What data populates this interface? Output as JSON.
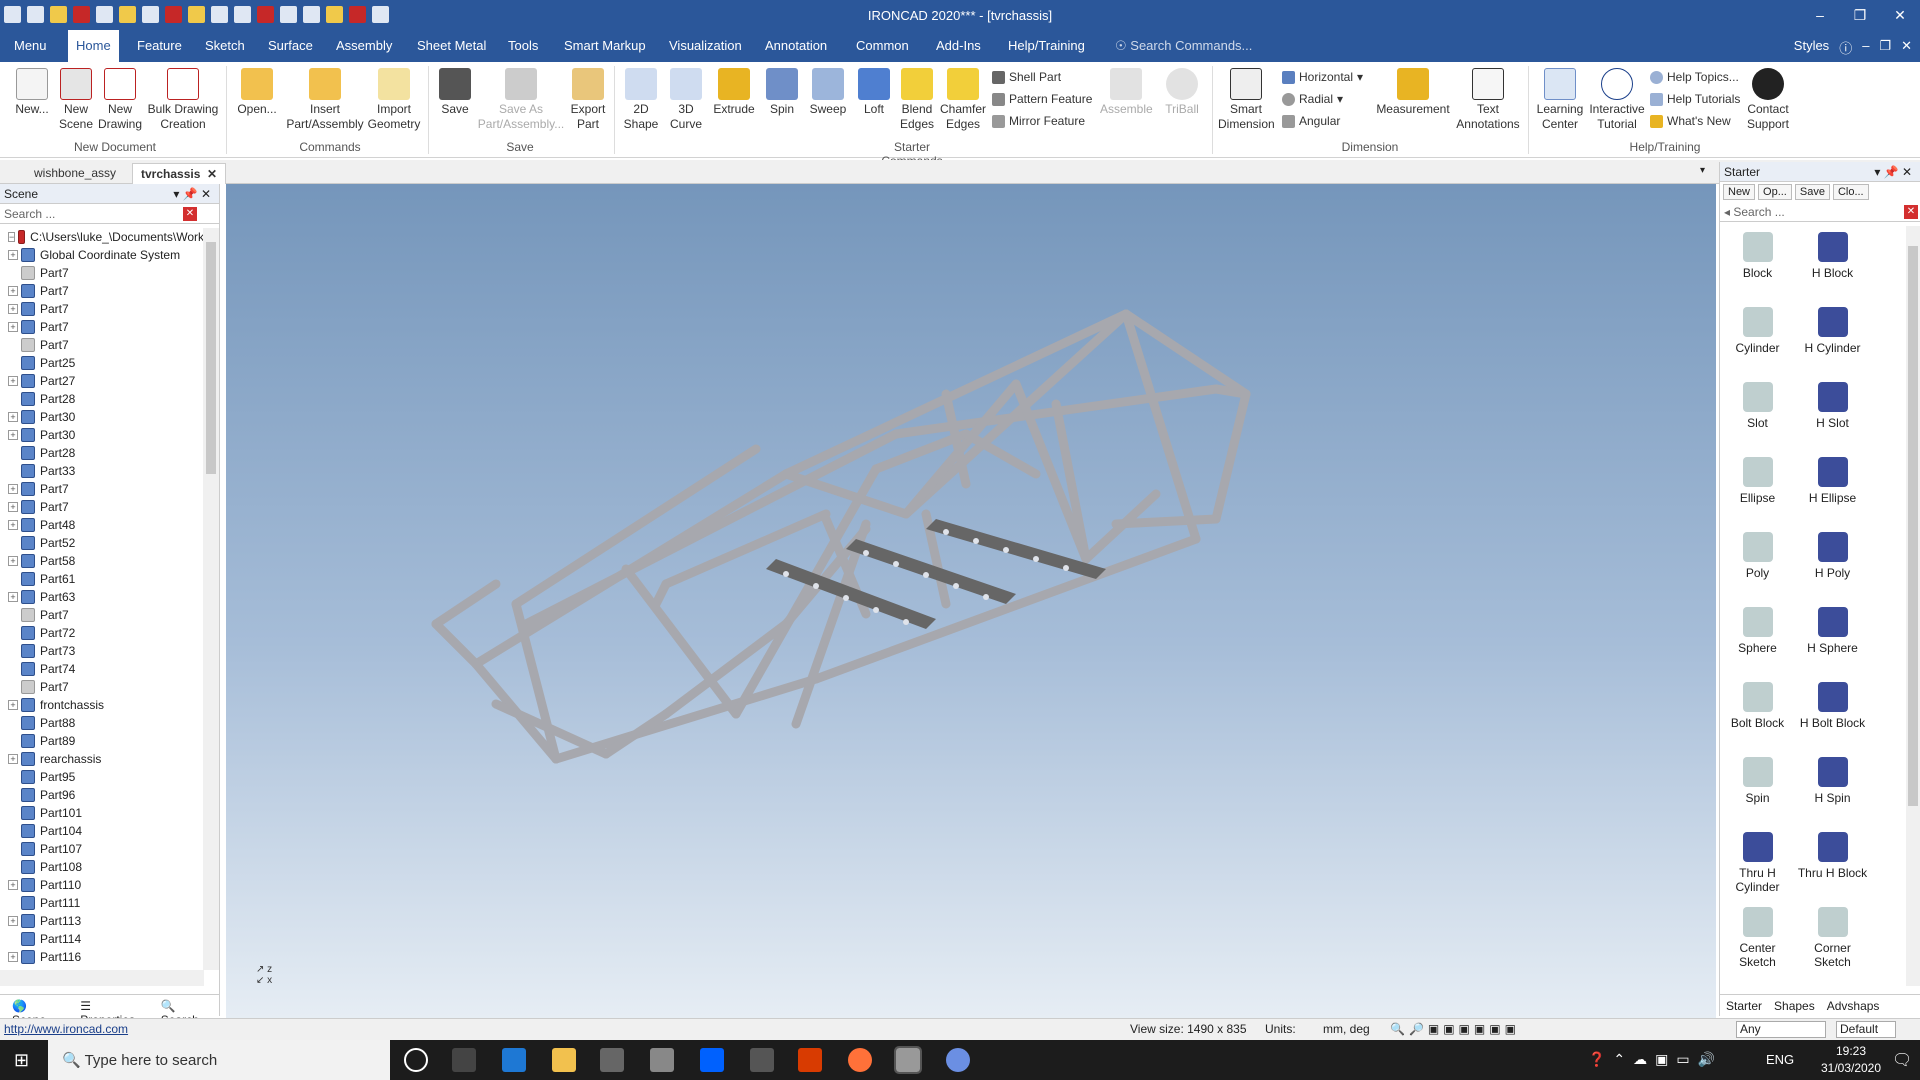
{
  "window": {
    "title": "IRONCAD 2020*** - [tvrchassis]"
  },
  "ribbon_tabs": [
    "Menu",
    "Home",
    "Feature",
    "Sketch",
    "Surface",
    "Assembly",
    "Sheet Metal",
    "Tools",
    "Smart Markup",
    "Visualization",
    "Annotation",
    "Common",
    "Add-Ins",
    "Help/Training"
  ],
  "ribbon_search_placeholder": "Search Commands...",
  "ribbon_right": {
    "styles": "Styles"
  },
  "ribbon": {
    "new_doc": [
      "New...",
      "New Scene",
      "New Drawing",
      "Bulk Drawing Creation"
    ],
    "commands": [
      "Open...",
      "Insert Part/Assembly",
      "Import Geometry"
    ],
    "save": [
      "Save",
      "Save As Part/Assembly...",
      "Export Part"
    ],
    "starter": [
      "2D Shape",
      "3D Curve",
      "Extrude",
      "Spin",
      "Sweep",
      "Loft",
      "Blend Edges",
      "Chamfer Edges"
    ],
    "starter_small": [
      "Shell Part",
      "Pattern Feature",
      "Mirror Feature"
    ],
    "starter_dis": [
      "Assemble",
      "TriBall"
    ],
    "dimension": [
      "Smart Dimension",
      "Horizontal",
      "Radial",
      "Angular",
      "Measurement",
      "Text Annotations"
    ],
    "help": [
      "Learning Center",
      "Interactive Tutorial",
      "Help Topics...",
      "Help Tutorials",
      "What's New",
      "Contact Support"
    ],
    "groups": [
      "New Document",
      "Commands",
      "Save",
      "Starter Commands",
      "Dimension",
      "Help/Training"
    ]
  },
  "doc_tabs": [
    "wishbone_assy",
    "tvrchassis"
  ],
  "scene_panel": {
    "title": "Scene",
    "search_placeholder": "Search ...",
    "root": "C:\\Users\\luke_\\Documents\\Work",
    "items": [
      {
        "label": "Global Coordinate System",
        "exp": true
      },
      {
        "label": "Part7",
        "exp": false,
        "g": true
      },
      {
        "label": "Part7",
        "exp": true
      },
      {
        "label": "Part7",
        "exp": true
      },
      {
        "label": "Part7",
        "exp": true
      },
      {
        "label": "Part7",
        "exp": false,
        "g": true
      },
      {
        "label": "Part25",
        "exp": false
      },
      {
        "label": "Part27",
        "exp": true
      },
      {
        "label": "Part28",
        "exp": false
      },
      {
        "label": "Part30",
        "exp": true
      },
      {
        "label": "Part30",
        "exp": true
      },
      {
        "label": "Part28",
        "exp": false
      },
      {
        "label": "Part33",
        "exp": false
      },
      {
        "label": "Part7",
        "exp": true
      },
      {
        "label": "Part7",
        "exp": true
      },
      {
        "label": "Part48",
        "exp": true
      },
      {
        "label": "Part52",
        "exp": false
      },
      {
        "label": "Part58",
        "exp": true
      },
      {
        "label": "Part61",
        "exp": false
      },
      {
        "label": "Part63",
        "exp": true
      },
      {
        "label": "Part7",
        "exp": false,
        "g": true
      },
      {
        "label": "Part72",
        "exp": false
      },
      {
        "label": "Part73",
        "exp": false
      },
      {
        "label": "Part74",
        "exp": false
      },
      {
        "label": "Part7",
        "exp": false,
        "g": true
      },
      {
        "label": "frontchassis",
        "exp": true
      },
      {
        "label": "Part88",
        "exp": false
      },
      {
        "label": "Part89",
        "exp": false
      },
      {
        "label": "rearchassis",
        "exp": true
      },
      {
        "label": "Part95",
        "exp": false
      },
      {
        "label": "Part96",
        "exp": false
      },
      {
        "label": "Part101",
        "exp": false
      },
      {
        "label": "Part104",
        "exp": false
      },
      {
        "label": "Part107",
        "exp": false
      },
      {
        "label": "Part108",
        "exp": false
      },
      {
        "label": "Part110",
        "exp": true
      },
      {
        "label": "Part111",
        "exp": false
      },
      {
        "label": "Part113",
        "exp": true
      },
      {
        "label": "Part114",
        "exp": false
      },
      {
        "label": "Part116",
        "exp": true
      }
    ],
    "bottom_tabs": [
      "Scene",
      "Properties",
      "Search"
    ]
  },
  "starter_panel": {
    "title": "Starter",
    "buttons": [
      "New",
      "Op...",
      "Save",
      "Clo..."
    ],
    "search_placeholder": "Search ...",
    "items": [
      {
        "label": "Block",
        "h": false
      },
      {
        "label": "H Block",
        "h": true
      },
      {
        "label": "Cylinder",
        "h": false
      },
      {
        "label": "H Cylinder",
        "h": true
      },
      {
        "label": "Slot",
        "h": false
      },
      {
        "label": "H Slot",
        "h": true
      },
      {
        "label": "Ellipse",
        "h": false
      },
      {
        "label": "H Ellipse",
        "h": true
      },
      {
        "label": "Poly",
        "h": false
      },
      {
        "label": "H Poly",
        "h": true
      },
      {
        "label": "Sphere",
        "h": false
      },
      {
        "label": "H Sphere",
        "h": true
      },
      {
        "label": "Bolt Block",
        "h": false
      },
      {
        "label": "H Bolt Block",
        "h": true
      },
      {
        "label": "Spin",
        "h": false
      },
      {
        "label": "H Spin",
        "h": true
      },
      {
        "label": "Thru H Cylinder",
        "h": true
      },
      {
        "label": "Thru H Block",
        "h": true
      },
      {
        "label": "Center Sketch",
        "h": false
      },
      {
        "label": "Corner Sketch",
        "h": false
      }
    ],
    "tabs": [
      "Starter",
      "Shapes",
      "Advshaps"
    ]
  },
  "status": {
    "url": "http://www.ironcad.com",
    "view_size": "View size: 1490 x  835",
    "units_label": "Units:",
    "units": "mm, deg",
    "filter": "Any",
    "style": "Default"
  },
  "taskbar": {
    "search_placeholder": "Type here to search",
    "lang": "ENG",
    "time": "19:23",
    "date": "31/03/2020"
  },
  "colors": {
    "accent": "#2b579a",
    "tube": "#b7b8be"
  }
}
